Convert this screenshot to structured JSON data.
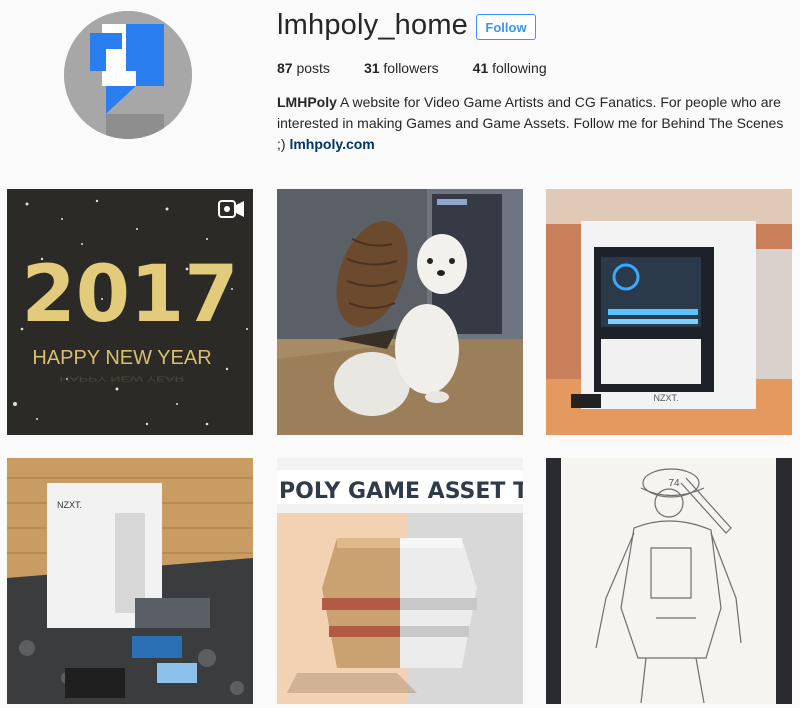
{
  "profile": {
    "username": "lmhpoly_home",
    "follow_label": "Follow",
    "stats": {
      "posts_count": "87",
      "posts_label": "posts",
      "followers_count": "31",
      "followers_label": "followers",
      "following_count": "41",
      "following_label": "following"
    },
    "bio": {
      "name": "LMHPoly",
      "text": " A website for Video Game Artists and CG Fanatics. For people who are interested in making Games and Game Assets. Follow me for Behind The Scenes ;) ",
      "link": "lmhpoly.com"
    }
  },
  "posts": [
    {
      "year": "2017",
      "caption": "HAPPY NEW YEAR",
      "icon": "video-icon"
    },
    {
      "icon": "none"
    },
    {
      "case_label": "NZXT."
    },
    {
      "case_label": "NZXT."
    },
    {
      "banner": "POLY GAME ASSET TUT"
    },
    {
      "helmet_number": "74"
    }
  ],
  "colors": {
    "accent": "#3897f0",
    "link": "#003569",
    "background": "#fafafa"
  }
}
